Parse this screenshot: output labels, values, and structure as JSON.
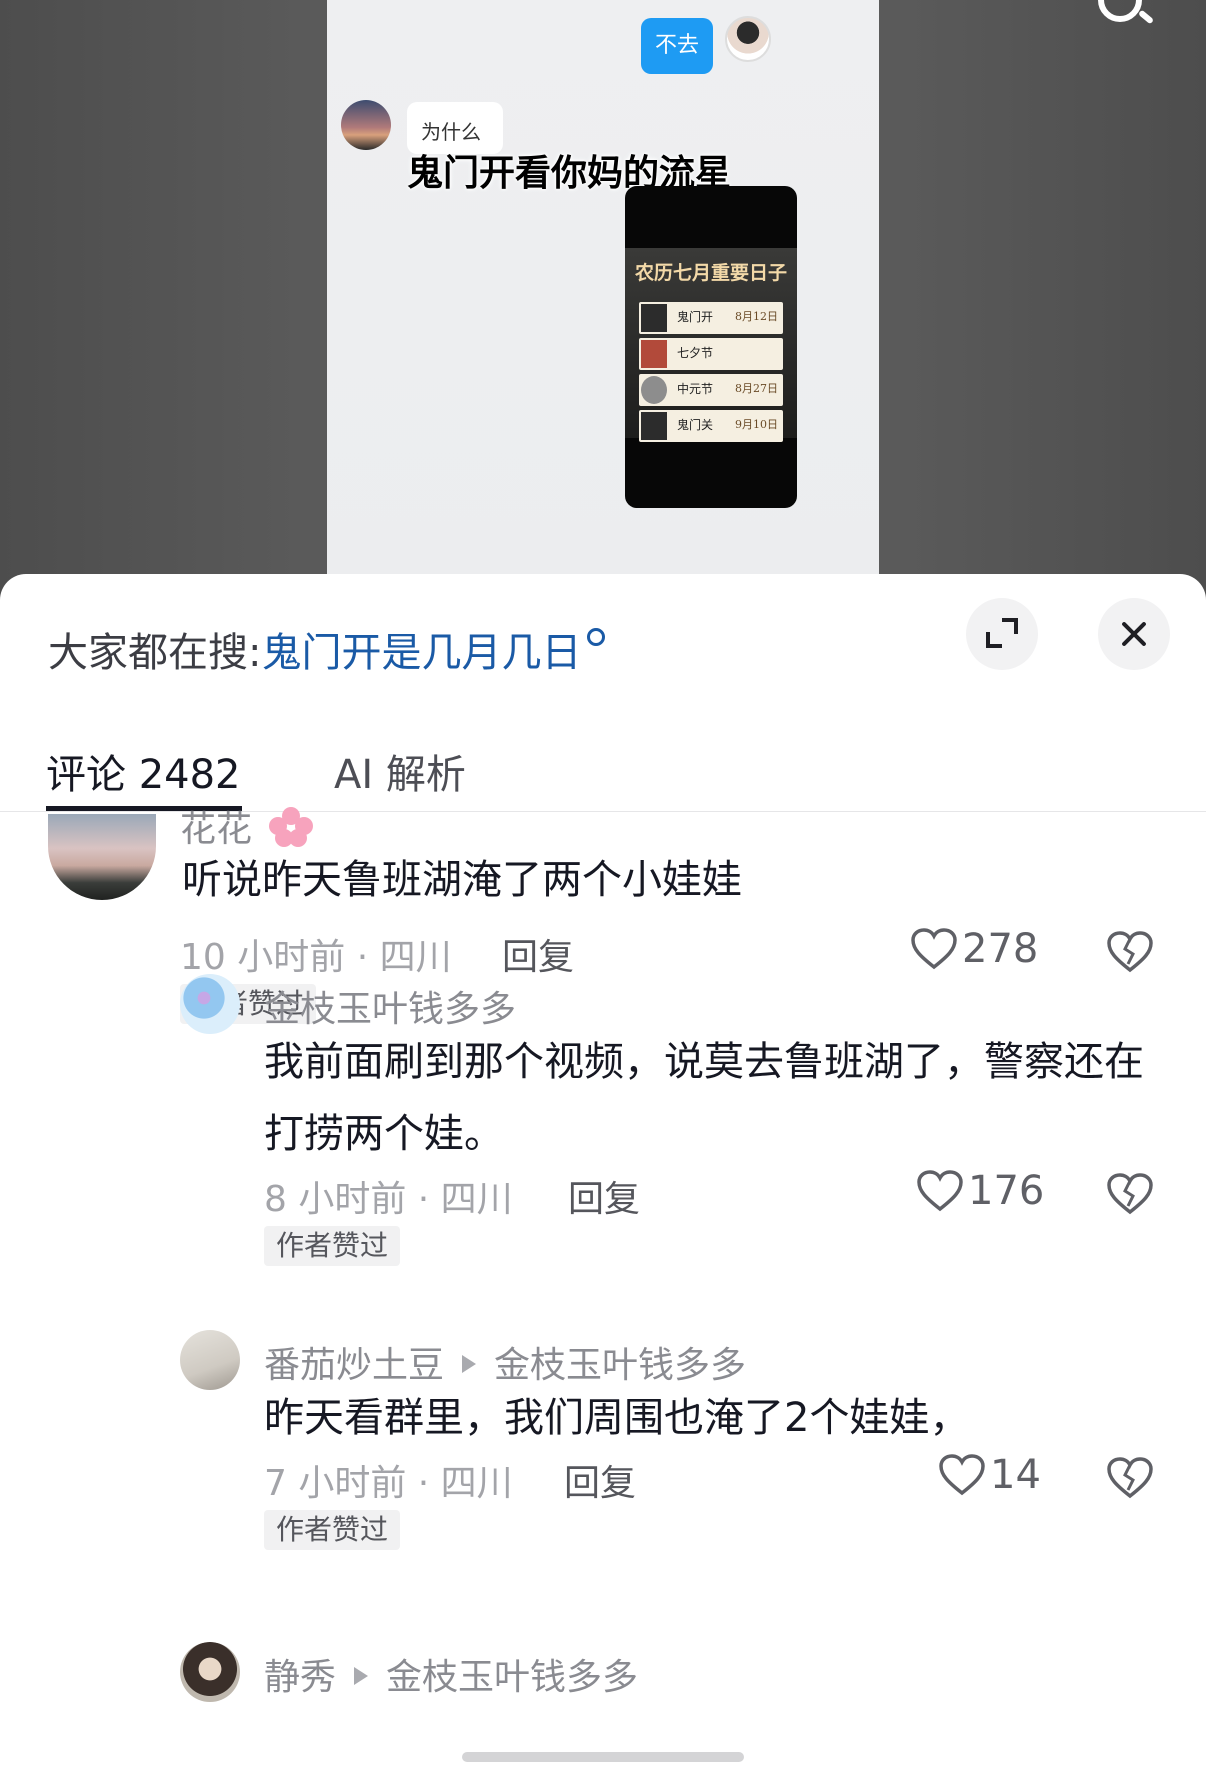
{
  "video": {
    "bubble_right": "不去",
    "bubble_left": "为什么",
    "caption": "鬼门开看你妈的流星",
    "card": {
      "title": "农历七月重要日子",
      "rows": [
        {
          "name": "鬼门开",
          "date": "8月12日"
        },
        {
          "name": "七夕节",
          "date": ""
        },
        {
          "name": "中元节",
          "date": "8月27日"
        },
        {
          "name": "鬼门关",
          "date": "9月10日"
        }
      ]
    }
  },
  "sheet": {
    "trending_label": "大家都在搜:",
    "trending_query": "鬼门开是几月几日",
    "tabs": {
      "comments": "评论 2482",
      "ai": "AI 解析"
    }
  },
  "comments": [
    {
      "name": "花花",
      "text": "听说昨天鲁班湖淹了两个小娃娃",
      "meta": "10 小时前 · 四川",
      "reply": "回复",
      "badge": "作者赞过",
      "likes": "278"
    },
    {
      "name": "金枝玉叶钱多多",
      "text": "我前面刷到那个视频，说莫去鲁班湖了，警察还在打捞两个娃。",
      "meta": "8 小时前 · 四川",
      "reply": "回复",
      "badge": "作者赞过",
      "likes": "176"
    },
    {
      "name": "番茄炒土豆",
      "reply_to": "金枝玉叶钱多多",
      "text": "昨天看群里，我们周围也淹了2个娃娃，",
      "meta": "7 小时前 · 四川",
      "reply": "回复",
      "badge": "作者赞过",
      "likes": "14"
    },
    {
      "name": "静秀",
      "reply_to": "金枝玉叶钱多多"
    }
  ],
  "icons": {
    "search": "search-icon",
    "expand": "expand-icon",
    "close": "close-icon",
    "like": "heart-icon",
    "dislike": "broken-heart-icon"
  },
  "colors": {
    "accent_link": "#1a5aa6",
    "chat_blue": "#1e9bf3"
  }
}
